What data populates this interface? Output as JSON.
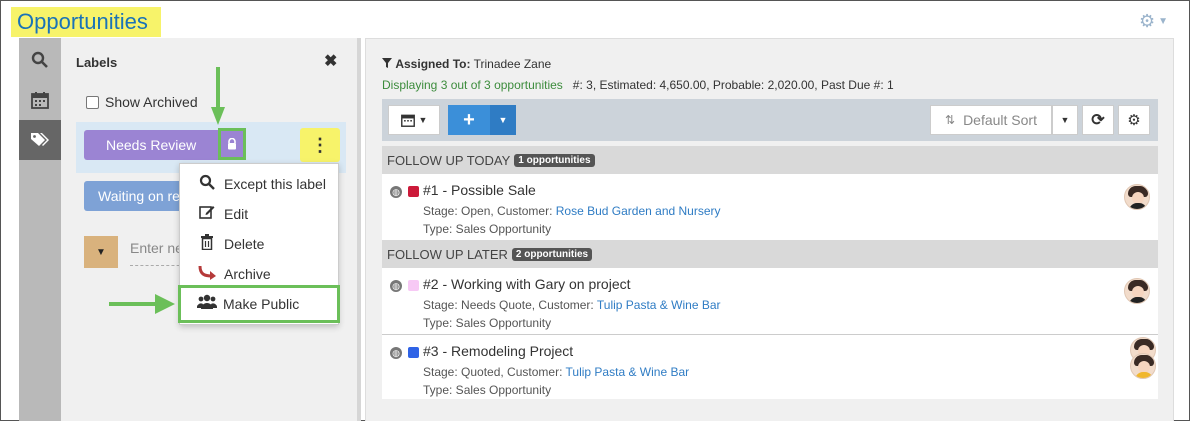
{
  "page": {
    "title": "Opportunities"
  },
  "rail": {
    "items": [
      "search",
      "calendar",
      "labels"
    ]
  },
  "labels_panel": {
    "heading": "Labels",
    "close_glyph": "✖",
    "show_archived": "Show Archived",
    "labels": [
      {
        "name": "Needs Review",
        "color": "#9b84d3"
      },
      {
        "name": "Waiting on re",
        "color": "#7ea2d6"
      }
    ],
    "new_label_placeholder": "Enter ne",
    "more_glyph": "⋮"
  },
  "context_menu": {
    "items": [
      {
        "label": "Except this label",
        "icon": "search-icon"
      },
      {
        "label": "Edit",
        "icon": "edit-icon"
      },
      {
        "label": "Delete",
        "icon": "trash-icon"
      },
      {
        "label": "Archive",
        "icon": "archive-icon"
      },
      {
        "label": "Make Public",
        "icon": "users-icon"
      }
    ]
  },
  "main": {
    "assigned_label": "Assigned To:",
    "assigned_value": "Trinadee Zane",
    "displaying": "Displaying 3 out of 3 opportunities",
    "summary": "#: 3, Estimated: 4,650.00, Probable: 2,020.00, Past Due #: 1",
    "sort_label": "Default Sort",
    "sections": [
      {
        "title": "FOLLOW UP TODAY",
        "badge": "1 opportunities"
      },
      {
        "title": "FOLLOW UP LATER",
        "badge": "2 opportunities"
      }
    ],
    "opportunities": [
      {
        "title": "#1 - Possible Sale",
        "stage": "Stage: Open, Customer:",
        "customer": "Rose Bud Garden and Nursery",
        "type": "Type: Sales Opportunity",
        "color": "#cc1a3a"
      },
      {
        "title": "#2 - Working with Gary on project",
        "stage": "Stage: Needs Quote, Customer:",
        "customer": "Tulip Pasta & Wine Bar",
        "type": "Type: Sales Opportunity",
        "color": "#f7c9f5"
      },
      {
        "title": "#3 - Remodeling Project",
        "stage": "Stage: Quoted, Customer:",
        "customer": "Tulip Pasta & Wine Bar",
        "type": "Type: Sales Opportunity",
        "color": "#2f63e6"
      }
    ]
  },
  "colors": {
    "highlight_yellow": "#f7f36a",
    "annotation_green": "#6bbf59",
    "title_blue": "#1a73b8",
    "link_blue": "#2f7cc4"
  }
}
